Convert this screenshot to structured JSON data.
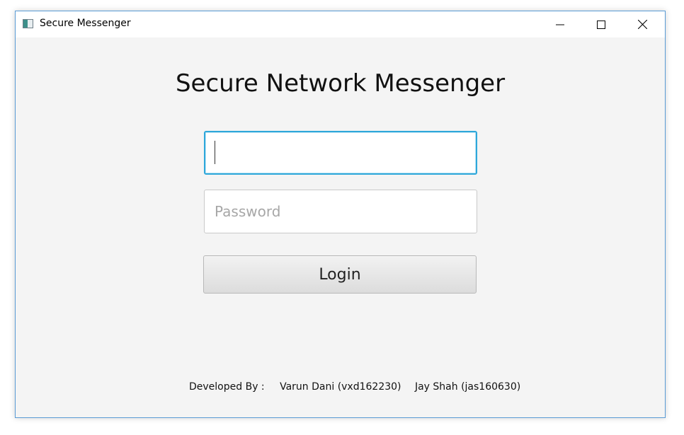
{
  "window": {
    "title": "Secure Messenger",
    "icon": "app-window-icon",
    "controls": {
      "minimize_icon": "minimize-icon",
      "maximize_icon": "maximize-icon",
      "close_icon": "close-icon"
    }
  },
  "login": {
    "heading": "Secure Network Messenger",
    "username_value": "",
    "password_placeholder": "Password",
    "login_label": "Login"
  },
  "footer": {
    "developed_by": "Developed By :",
    "developer_1": "Varun Dani (vxd162230)",
    "developer_2": "Jay Shah (jas160630)"
  },
  "colors": {
    "window_border": "#5a9bd5",
    "focus_border": "#2ea7da",
    "background": "#f4f4f4"
  }
}
